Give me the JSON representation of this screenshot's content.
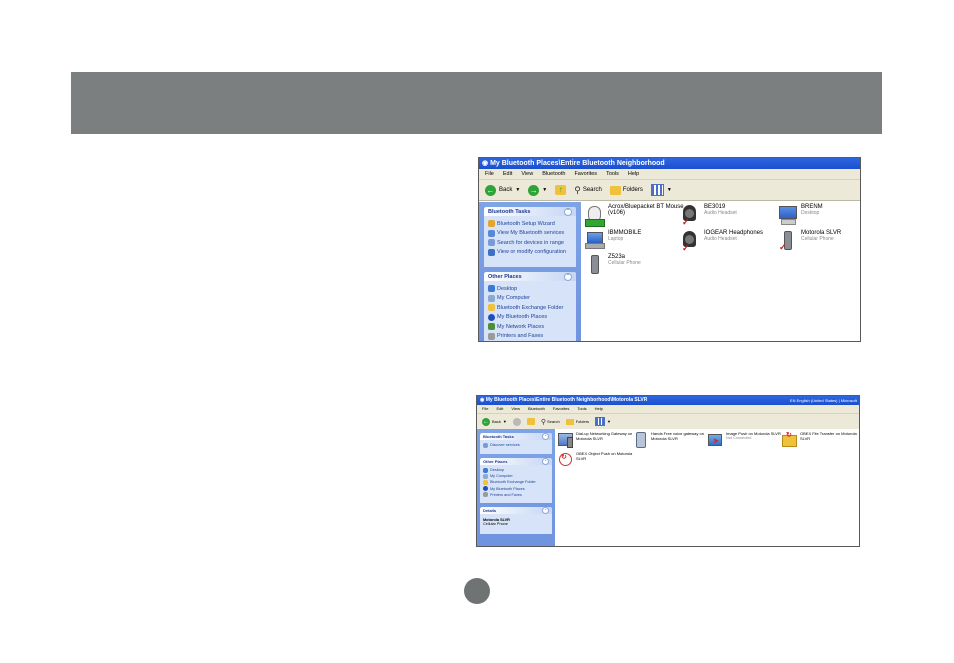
{
  "colors": {
    "banner": "#7b7f80",
    "title_bar": "#2f66e0",
    "task_pane": "#7ea4e7",
    "page_circle": "#6f7374"
  },
  "window1": {
    "title": "My Bluetooth Places\\Entire Bluetooth Neighborhood",
    "menu": [
      "File",
      "Edit",
      "View",
      "Bluetooth",
      "Favorites",
      "Tools",
      "Help"
    ],
    "toolbar": {
      "back": "Back",
      "search": "Search",
      "folders": "Folders"
    },
    "bluetooth_tasks": {
      "title": "Bluetooth Tasks",
      "items": [
        "Bluetooth Setup Wizard",
        "View My Bluetooth services",
        "Search for devices in range",
        "View or modify configuration"
      ]
    },
    "other_places": {
      "title": "Other Places",
      "items": [
        "Desktop",
        "My Computer",
        "Bluetooth Exchange Folder",
        "My Bluetooth Places",
        "My Network Places",
        "Printers and Faxes"
      ]
    },
    "devices": [
      {
        "name": "Acrox/Bluepacket BT Mouse",
        "sub": "(v106)",
        "icon": "mouse-icon"
      },
      {
        "name": "BE3019",
        "sub": "Audio Headset",
        "icon": "headset-icon"
      },
      {
        "name": "BRENM",
        "sub": "Desktop",
        "icon": "desktop-icon"
      },
      {
        "name": "IBMMOBILE",
        "sub": "Laptop",
        "icon": "laptop-icon"
      },
      {
        "name": "IOGEAR Headphones",
        "sub": "Audio Headset",
        "icon": "headset-icon"
      },
      {
        "name": "Motorola SLVR",
        "sub": "Cellular Phone",
        "icon": "phone-icon"
      },
      {
        "name": "Z523a",
        "sub": "Cellular Phone",
        "icon": "phone-icon"
      }
    ]
  },
  "window2": {
    "title": "My Bluetooth Places\\Entire Bluetooth Neighborhood\\Motorola SLVR",
    "title_right": "EN English (United States)",
    "title_right2": "Microsoft",
    "menu": [
      "File",
      "Edit",
      "View",
      "Bluetooth",
      "Favorites",
      "Tools",
      "Help"
    ],
    "toolbar": {
      "back": "Back",
      "search": "Search",
      "folders": "Folders"
    },
    "bluetooth_tasks": {
      "title": "Bluetooth Tasks",
      "items": [
        "Discover services"
      ]
    },
    "other_places": {
      "title": "Other Places",
      "items": [
        "Desktop",
        "My Computer",
        "Bluetooth Exchange Folder",
        "My Bluetooth Places",
        "Printers and Faxes"
      ]
    },
    "details": {
      "title": "Details",
      "name": "Motorola SLVR",
      "type": "Cellular Phone"
    },
    "services": [
      {
        "name": "Dial-up Networking Gateway on",
        "name2": "Motorola SLVR",
        "icon": "dialup-icon"
      },
      {
        "name": "Hands Free voice gateway on",
        "name2": "Motorola SLVR",
        "icon": "handsfree-icon"
      },
      {
        "name": "Image Push on Motorola SLVR",
        "name2": "Not Connected",
        "icon": "image-push-icon"
      },
      {
        "name": "OBEX File Transfer on Motorola",
        "name2": "SLVR",
        "icon": "file-transfer-icon"
      },
      {
        "name": "OBEX Object Push on Motorola",
        "name2": "SLVR",
        "icon": "object-push-icon"
      }
    ]
  }
}
